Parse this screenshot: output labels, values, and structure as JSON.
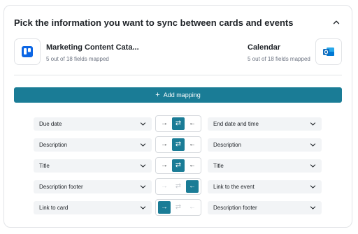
{
  "header": {
    "title": "Pick the information you want to sync between cards and events"
  },
  "source": {
    "name": "Marketing Content Cata...",
    "fields_mapped": "5 out of 18 fields mapped",
    "icon": "trello-icon",
    "color": "#0c66e4"
  },
  "target": {
    "name": "Calendar",
    "fields_mapped": "5 out of 18 fields mapped",
    "icon": "outlook-icon",
    "color": "#0f6cbd"
  },
  "add_mapping": {
    "label": "Add mapping",
    "icon": "plus-icon"
  },
  "accent": "#1a7c96",
  "mappings": [
    {
      "source_field": "Due date",
      "target_field": "End date and time",
      "direction": "both",
      "arrows": [
        "→",
        "⇄",
        "←"
      ]
    },
    {
      "source_field": "Description",
      "target_field": "Description",
      "direction": "both",
      "arrows": [
        "→",
        "⇄",
        "←"
      ]
    },
    {
      "source_field": "Title",
      "target_field": "Title",
      "direction": "both",
      "arrows": [
        "→",
        "⇄",
        "←"
      ]
    },
    {
      "source_field": "Description footer",
      "target_field": "Link to the event",
      "direction": "to-source",
      "arrows": [
        "→",
        "⇄",
        "←"
      ]
    },
    {
      "source_field": "Link to card",
      "target_field": "Description footer",
      "direction": "to-target",
      "arrows": [
        "→",
        "⇄",
        "←"
      ]
    }
  ]
}
